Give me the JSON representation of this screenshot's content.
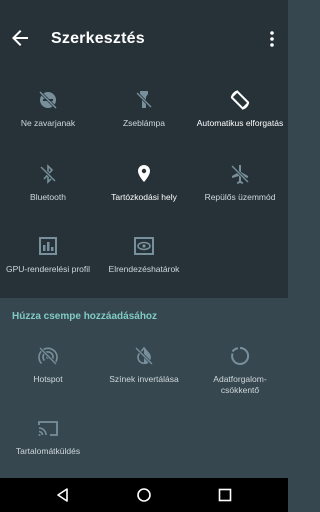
{
  "header": {
    "title": "Szerkesztés"
  },
  "current_tiles": [
    {
      "label": "Ne zavarjanak",
      "icon": "do-not-disturb-off-icon",
      "active": false
    },
    {
      "label": "Zseblámpa",
      "icon": "flashlight-off-icon",
      "active": false
    },
    {
      "label": "Automatikus elforgatás",
      "icon": "auto-rotate-icon",
      "active": true
    },
    {
      "label": "Bluetooth",
      "icon": "bluetooth-disabled-icon",
      "active": false
    },
    {
      "label": "Tartózkodási hely",
      "icon": "location-pin-icon",
      "active": true
    },
    {
      "label": "Repülős üzemmód",
      "icon": "airplane-off-icon",
      "active": false
    },
    {
      "label": "GPU-renderelési profil",
      "icon": "gpu-profile-icon",
      "active": false
    },
    {
      "label": "Elrendezéshatárok",
      "icon": "layout-bounds-icon",
      "active": false
    }
  ],
  "add_section": {
    "title": "Húzza csempe hozzáadásához",
    "tiles": [
      {
        "label": "Hotspot",
        "icon": "hotspot-off-icon"
      },
      {
        "label": "Színek invertálása",
        "icon": "invert-colors-icon"
      },
      {
        "label": "Adatforgalom-\ncsökkentő",
        "label_line1": "Adatforgalom-",
        "label_line2": "csökkentő",
        "icon": "data-saver-icon"
      },
      {
        "label": "Tartalomátküldés",
        "icon": "cast-icon"
      }
    ]
  },
  "colors": {
    "header_bg": "#263238",
    "body_bg": "#37474f",
    "accent": "#80cbc4"
  }
}
